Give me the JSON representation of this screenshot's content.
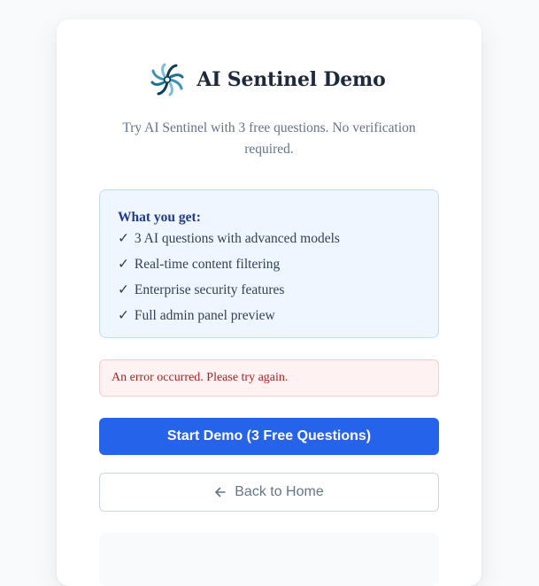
{
  "header": {
    "title": "AI Sentinel Demo",
    "logo_icon": "sentinel-swirl-icon"
  },
  "subtitle": "Try AI Sentinel with 3 free questions. No verification required.",
  "features": {
    "heading": "What you get:",
    "items": [
      {
        "check": "✓",
        "label": "3 AI questions with advanced models"
      },
      {
        "check": "✓",
        "label": "Real-time content filtering"
      },
      {
        "check": "✓",
        "label": "Enterprise security features"
      },
      {
        "check": "✓",
        "label": "Full admin panel preview"
      }
    ]
  },
  "error": {
    "message": "An error occurred. Please try again."
  },
  "actions": {
    "start_label": "Start Demo (3 Free Questions)",
    "back_label": "Back to Home",
    "back_icon": "arrow-left-icon"
  },
  "colors": {
    "primary": "#2563eb",
    "features_bg": "#eff6ff",
    "features_border": "#bfdbfe",
    "error_bg": "#fef2f2",
    "error_text": "#b91c1c",
    "title_text": "#1e293b",
    "muted_text": "#64748b"
  }
}
